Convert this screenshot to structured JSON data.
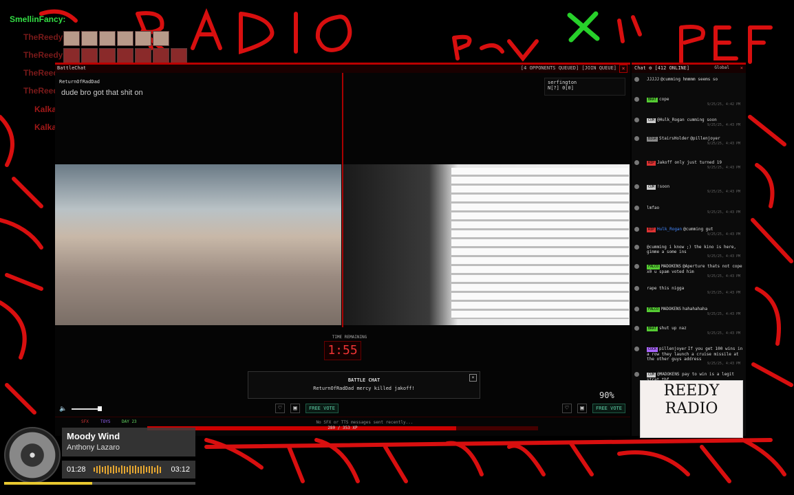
{
  "overlay": {
    "chatters": [
      {
        "name": "SmellinFancy:",
        "dim": false
      },
      {
        "name": "TheReedy:",
        "dim": true
      },
      {
        "name": "TheReedy:",
        "dim": true
      },
      {
        "name": "TheReedy:",
        "dim": true
      },
      {
        "name": "TheReedy:",
        "dim": true
      },
      {
        "name": "Kalkalaka:",
        "dim": false
      },
      {
        "name": "Kalkalaka:",
        "dim": false
      }
    ]
  },
  "battle": {
    "title": "BattleChat",
    "queue": "[4 OPPONENTS QUEUED] [JOIN QUEUE]",
    "close": "×",
    "left_user": "ReturnOfRadDad",
    "left_message": "dude bro got that shit on",
    "right_user_line1": "serfington",
    "right_user_line2": "N[?] 0[0]",
    "timer_label": "TIME REMAINING",
    "timer": "1:55",
    "chatbox_title": "BATTLE CHAT",
    "chatbox_message": "ReturnOfRadDad mercy killed jakoff!",
    "chatbox_close": "×",
    "free_vote_left": "FREE VOTE",
    "free_vote_right": "FREE VOTE",
    "percent": "90%",
    "no_sfx": "No SFX or TTS messages sent recently...",
    "tags": [
      "SFX",
      "TOYS",
      "DAY 23"
    ],
    "xp_text": "280 / 353 XP",
    "xp_fraction": 0.79
  },
  "chat": {
    "title": "Chat ⚙ [412 ONLINE]",
    "channel": "Global",
    "close": "×",
    "messages": [
      {
        "badge": "",
        "badge_color": "",
        "user": "JJJJJ",
        "user_color": "#ddd",
        "text": "@cumming hmmmm seems so",
        "time": ""
      },
      {
        "badge": "BRAT",
        "badge_color": "#55cc33",
        "user": "",
        "user_color": "#ddd",
        "text": "cope",
        "time": "9/25/25, 4:42 PM"
      },
      {
        "badge": "CUM",
        "badge_color": "#cccccc",
        "user": "",
        "user_color": "#ddd",
        "text": "@Hulk_Rogan cumming soon",
        "time": "9/25/25, 4:43 PM"
      },
      {
        "badge": "BIGR",
        "badge_color": "",
        "user": "StairsHolder",
        "user_color": "#dddddd",
        "text": "@pillenjoyer",
        "time": "9/25/25, 4:43 PM"
      },
      {
        "badge": "RIP",
        "badge_color": "#dd3333",
        "user": "",
        "user_color": "#ddd",
        "text": "Jakoff only just turned 19",
        "time": "9/25/25, 4:43 PM"
      },
      {
        "badge": "CUM",
        "badge_color": "#cccccc",
        "user": "",
        "user_color": "#ddd",
        "text": "!soon",
        "time": "9/25/25, 4:43 PM"
      },
      {
        "badge": "",
        "badge_color": "",
        "user": "",
        "user_color": "#ddd",
        "text": "lmfao",
        "time": "9/25/25, 4:43 PM"
      },
      {
        "badge": "RIP",
        "badge_color": "#dd3333",
        "user": "Hulk_Rogan",
        "user_color": "#4488ff",
        "text": "@cumming gut",
        "time": "9/25/25, 4:43 PM"
      },
      {
        "badge": "",
        "badge_color": "",
        "user": "",
        "user_color": "#ddd",
        "text": "@cumming i know ;) the kino is here, gimme a some ins",
        "time": "9/25/25, 4:43 PM"
      },
      {
        "badge": "FALCO",
        "badge_color": "#55cc33",
        "user": "MADOKENS",
        "user_color": "#dddddd",
        "text": "@Aperture thats not cope x0 u spam voted him",
        "time": "9/25/25, 4:43 PM"
      },
      {
        "badge": "",
        "badge_color": "",
        "user": "",
        "user_color": "#ddd",
        "text": "rape this nigga",
        "time": "9/25/25, 4:43 PM"
      },
      {
        "badge": "FALCO",
        "badge_color": "#55cc33",
        "user": "MADOKENS",
        "user_color": "#dddddd",
        "text": "hahahahaha",
        "time": "9/25/25, 4:43 PM"
      },
      {
        "badge": "BRAT",
        "badge_color": "#55cc33",
        "user": "",
        "user_color": "#ddd",
        "text": "shut up naz",
        "time": "9/25/25, 4:43 PM"
      },
      {
        "badge": "CUCK",
        "badge_color": "#aa66ff",
        "user": "pillenjoyer",
        "user_color": "#dddddd",
        "text": "If you get 100 wins in a row they launch a cruise missile at the other guys address",
        "time": "9/25/25, 4:43 PM"
      },
      {
        "badge": "CUM",
        "badge_color": "#cccccc",
        "user": "",
        "user_color": "#ddd",
        "text": "@MADOKENS pay to win is a legit strat tbf",
        "time": ""
      }
    ]
  },
  "logo": {
    "line1": "REEDY",
    "line2": "RADIO"
  },
  "now_playing": {
    "title": "Moody Wind",
    "artist": "Anthony Lazaro",
    "elapsed": "01:28",
    "total": "03:12",
    "progress_fraction": 0.46
  },
  "colors": {
    "accent": "#cc0000",
    "graffiti": "#e01010",
    "vote": "#5fd0a8"
  }
}
